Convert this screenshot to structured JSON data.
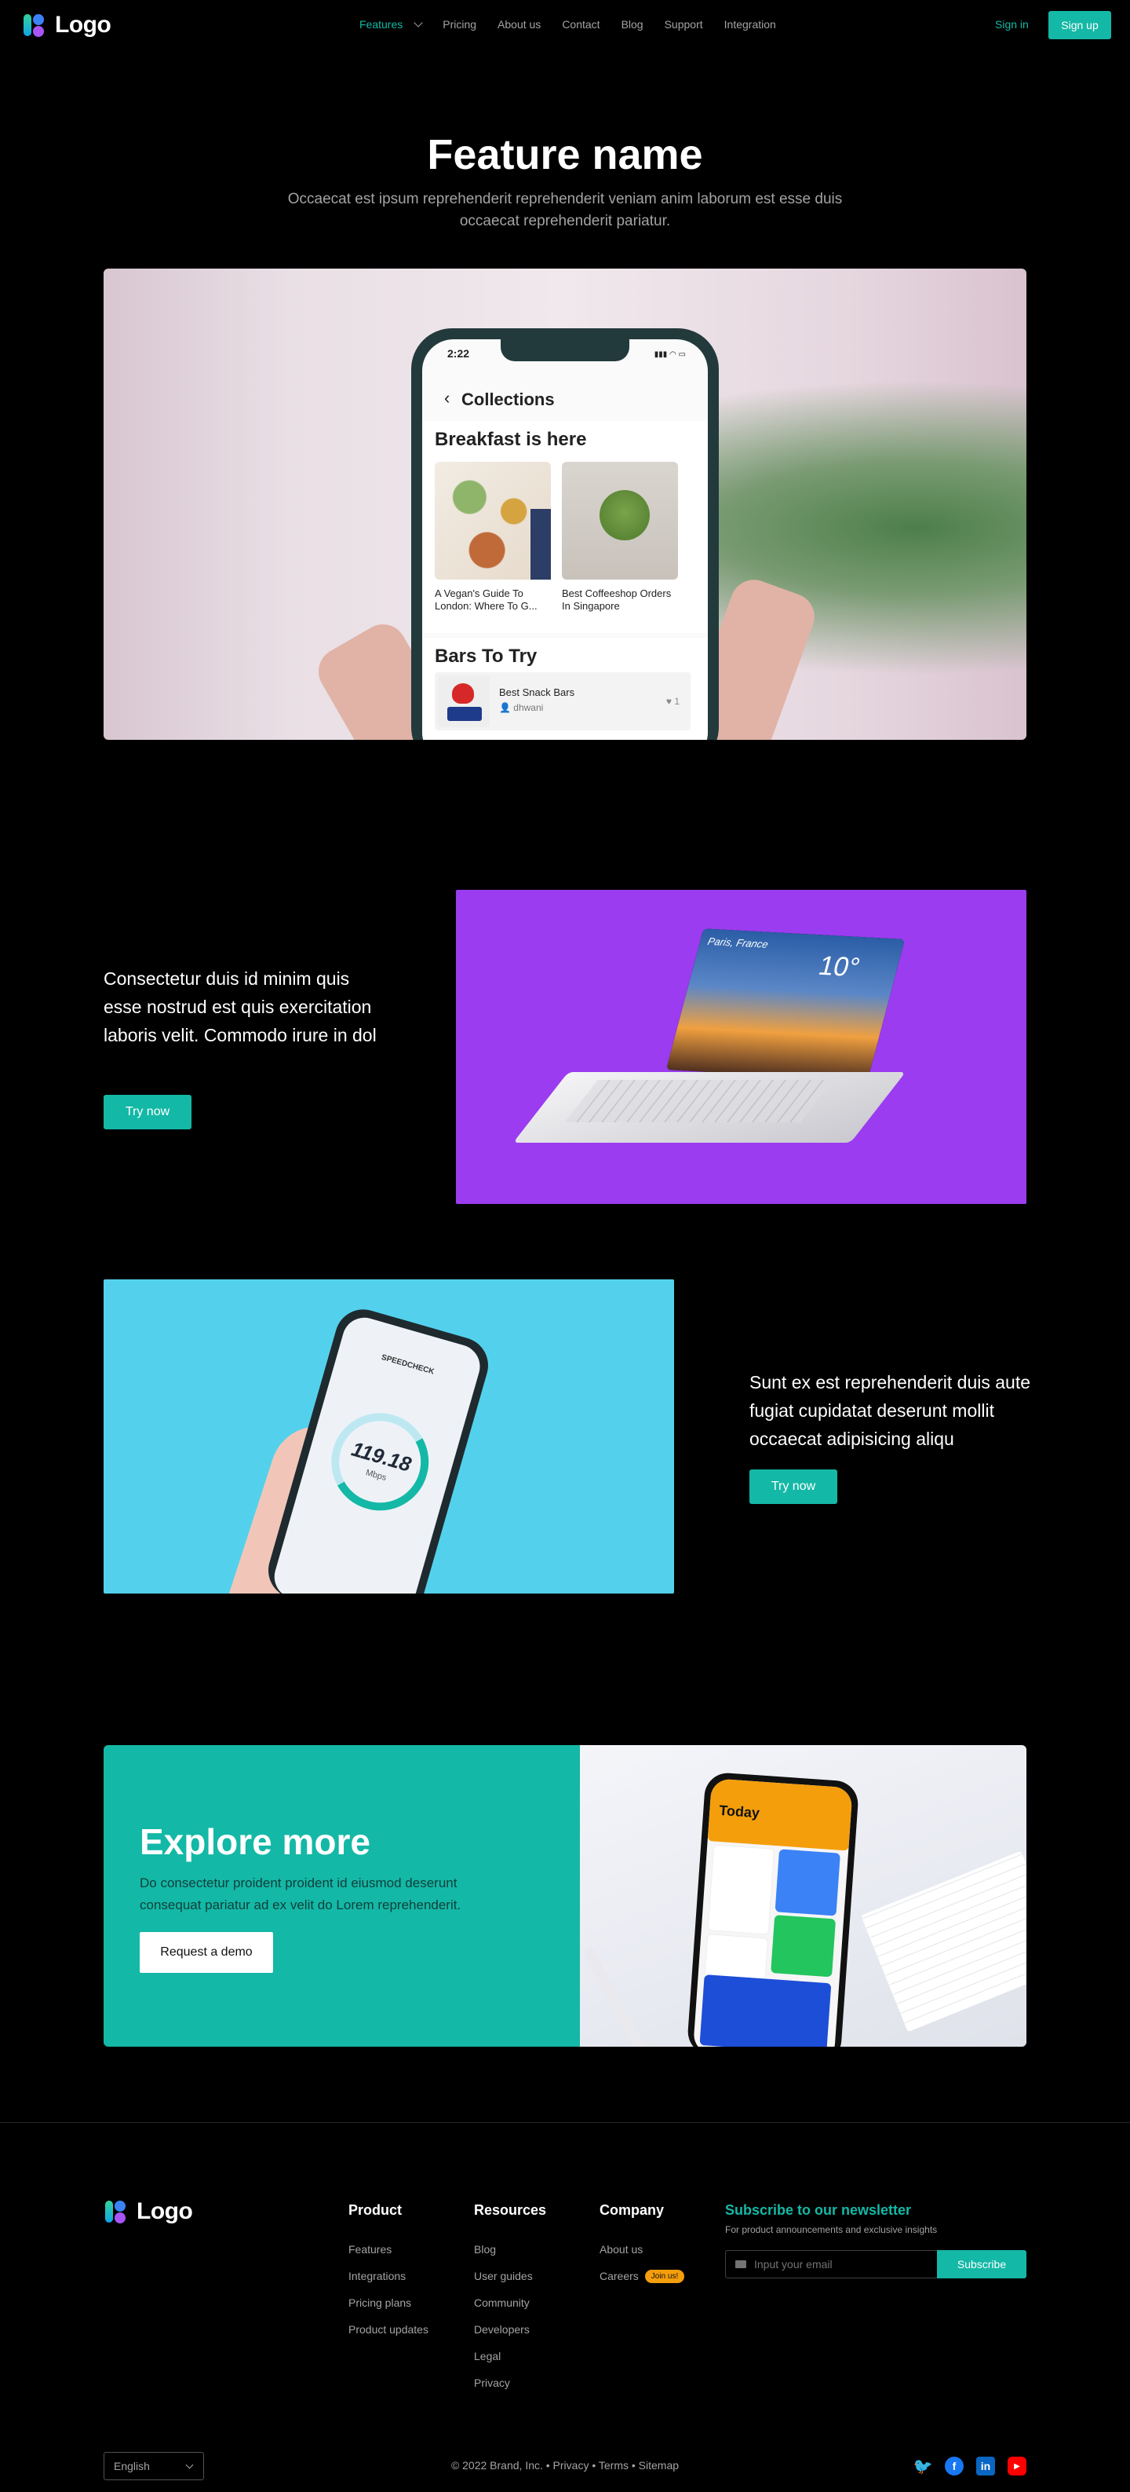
{
  "header": {
    "logo_text": "Logo",
    "nav": [
      "Features",
      "Pricing",
      "About us",
      "Contact",
      "Blog",
      "Support",
      "Integration"
    ],
    "sign_in": "Sign in",
    "sign_up": "Sign up"
  },
  "hero": {
    "title": "Feature name",
    "subtitle": "Occaecat est ipsum reprehenderit reprehenderit veniam anim laborum est esse duis occaecat reprehenderit pariatur.",
    "phone": {
      "time": "2:22",
      "back_title": "Collections",
      "section_title": "Breakfast is here",
      "cards": [
        "A Vegan's Guide To London: Where To G...",
        "Best Coffeeshop Orders In Singapore"
      ],
      "section2_title": "Bars To Try",
      "row_title": "Best Snack Bars",
      "row_user": "dhwani",
      "row_likes": "1"
    }
  },
  "feature1": {
    "text": "Consectetur duis id minim quis esse nostrud est quis exercitation laboris velit. Commodo irure in dol",
    "button": "Try now",
    "laptop_city": "Paris, France",
    "laptop_temp": "10°"
  },
  "feature2": {
    "text": "Sunt ex est reprehenderit duis aute fugiat cupidatat deserunt mollit occaecat adipisicing aliqu",
    "button": "Try now",
    "speed_brand": "SPEEDCHECK",
    "speed_value": "119.18",
    "speed_unit": "Mbps"
  },
  "explore": {
    "title": "Explore more",
    "subtitle": "Do consectetur proident proident id eiusmod deserunt consequat pariatur ad ex velit do Lorem reprehenderit.",
    "button": "Request a demo",
    "phone_title": "Today"
  },
  "footer": {
    "logo_text": "Logo",
    "product": {
      "title": "Product",
      "links": [
        "Features",
        "Integrations",
        "Pricing plans",
        "Product updates"
      ]
    },
    "resources": {
      "title": "Resources",
      "links": [
        "Blog",
        "User guides",
        "Community",
        "Developers",
        "Legal",
        "Privacy"
      ]
    },
    "company": {
      "title": "Company",
      "links": [
        "About us",
        "Careers"
      ],
      "badge": "Join us!"
    },
    "newsletter": {
      "title": "Subscribe to our newsletter",
      "subtitle": "For product announcements and exclusive insights",
      "placeholder": "Input your email",
      "button": "Subscribe"
    },
    "language": "English",
    "copyright": "© 2022 Brand, Inc. • Privacy • Terms • Sitemap",
    "socials": [
      {
        "name": "twitter-icon",
        "color": "#1DA1F2"
      },
      {
        "name": "facebook-icon",
        "color": "#1877F2"
      },
      {
        "name": "linkedin-icon",
        "color": "#0A66C2"
      },
      {
        "name": "youtube-icon",
        "color": "#FF0000"
      }
    ]
  },
  "colors": {
    "accent": "#14b8a6",
    "purple": "#9b3cf0",
    "cyan": "#53d1ec"
  }
}
